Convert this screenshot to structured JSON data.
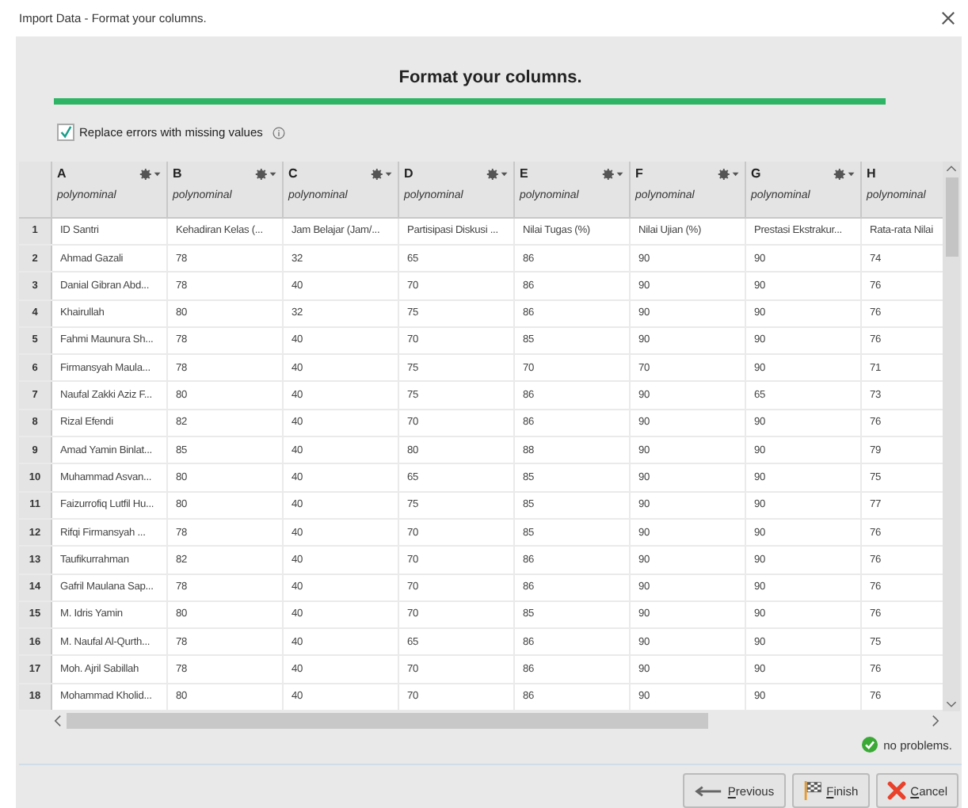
{
  "window": {
    "title": "Import Data - Format your columns."
  },
  "heading": "Format your columns.",
  "replace_errors": {
    "label": "Replace errors with missing values",
    "checked": true
  },
  "table": {
    "columns": [
      {
        "letter": "A",
        "type": "polynominal"
      },
      {
        "letter": "B",
        "type": "polynominal"
      },
      {
        "letter": "C",
        "type": "polynominal"
      },
      {
        "letter": "D",
        "type": "polynominal"
      },
      {
        "letter": "E",
        "type": "polynominal"
      },
      {
        "letter": "F",
        "type": "polynominal"
      },
      {
        "letter": "G",
        "type": "polynominal"
      },
      {
        "letter": "H",
        "type": "polynominal"
      }
    ],
    "rows": [
      {
        "num": "1",
        "cells": [
          "ID Santri",
          "Kehadiran Kelas (...",
          "Jam Belajar (Jam/...",
          "Partisipasi Diskusi ...",
          "Nilai Tugas (%)",
          "Nilai Ujian (%)",
          "Prestasi Ekstrakur...",
          "Rata-rata Nilai"
        ]
      },
      {
        "num": "2",
        "cells": [
          "Ahmad Gazali",
          "78",
          "32",
          "65",
          "86",
          "90",
          "90",
          "74"
        ]
      },
      {
        "num": "3",
        "cells": [
          "Danial Gibran Abd...",
          "78",
          "40",
          "70",
          "86",
          "90",
          "90",
          "76"
        ]
      },
      {
        "num": "4",
        "cells": [
          "Khairullah",
          "80",
          "32",
          "75",
          "86",
          "90",
          "90",
          "76"
        ]
      },
      {
        "num": "5",
        "cells": [
          "Fahmi Maunura Sh...",
          "78",
          "40",
          "70",
          "85",
          "90",
          "90",
          "76"
        ]
      },
      {
        "num": "6",
        "cells": [
          "Firmansyah Maula...",
          "78",
          "40",
          "75",
          "70",
          "70",
          "90",
          "71"
        ]
      },
      {
        "num": "7",
        "cells": [
          "Naufal Zakki Aziz F...",
          "80",
          "40",
          "75",
          "86",
          "90",
          "65",
          "73"
        ]
      },
      {
        "num": "8",
        "cells": [
          "Rizal Efendi",
          "82",
          "40",
          "70",
          "86",
          "90",
          "90",
          "76"
        ]
      },
      {
        "num": "9",
        "cells": [
          "Amad Yamin Binlat...",
          "85",
          "40",
          "80",
          "88",
          "90",
          "90",
          "79"
        ]
      },
      {
        "num": "10",
        "cells": [
          "Muhammad Asvan...",
          "80",
          "40",
          "65",
          "85",
          "90",
          "90",
          "75"
        ]
      },
      {
        "num": "11",
        "cells": [
          "Faizurrofiq Lutfil Hu...",
          "80",
          "40",
          "75",
          "85",
          "90",
          "90",
          "77"
        ]
      },
      {
        "num": "12",
        "cells": [
          "Rifqi Firmansyah ...",
          "78",
          "40",
          "70",
          "85",
          "90",
          "90",
          "76"
        ]
      },
      {
        "num": "13",
        "cells": [
          "Taufikurrahman",
          "82",
          "40",
          "70",
          "86",
          "90",
          "90",
          "76"
        ]
      },
      {
        "num": "14",
        "cells": [
          "Gafril Maulana Sap...",
          "78",
          "40",
          "70",
          "86",
          "90",
          "90",
          "76"
        ]
      },
      {
        "num": "15",
        "cells": [
          "M. Idris Yamin",
          "80",
          "40",
          "70",
          "85",
          "90",
          "90",
          "76"
        ]
      },
      {
        "num": "16",
        "cells": [
          "M. Naufal Al-Qurth...",
          "78",
          "40",
          "65",
          "86",
          "90",
          "90",
          "75"
        ]
      },
      {
        "num": "17",
        "cells": [
          "Moh. Ajril Sabillah",
          "78",
          "40",
          "70",
          "86",
          "90",
          "90",
          "76"
        ]
      },
      {
        "num": "18",
        "cells": [
          "Mohammad Kholid...",
          "80",
          "40",
          "70",
          "86",
          "90",
          "90",
          "76"
        ]
      }
    ]
  },
  "status": "no problems.",
  "buttons": [
    {
      "kind": "previous",
      "label": "Previous"
    },
    {
      "kind": "finish",
      "label": "Finish"
    },
    {
      "kind": "cancel",
      "label": "Cancel"
    }
  ]
}
